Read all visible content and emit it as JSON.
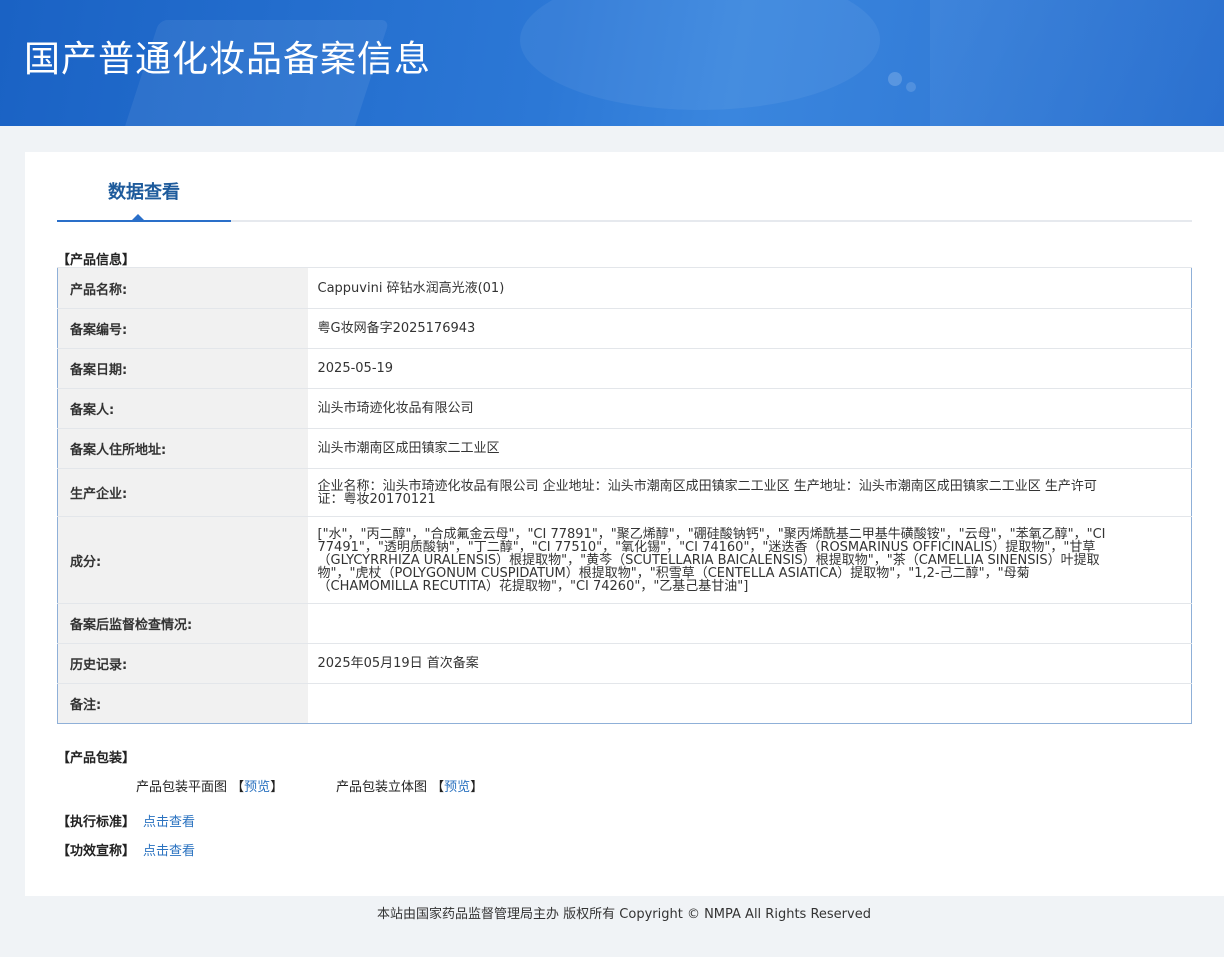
{
  "banner": {
    "title": "国产普通化妆品备案信息"
  },
  "tab": {
    "label": "数据查看"
  },
  "product_info": {
    "section_title": "【产品信息】",
    "rows": [
      {
        "key": "产品名称:",
        "value": "Cappuvini 碎钻水润高光液(01)"
      },
      {
        "key": "备案编号:",
        "value": "粤G妆网备字2025176943"
      },
      {
        "key": "备案日期:",
        "value": "2025-05-19"
      },
      {
        "key": "备案人:",
        "value": "汕头市琦迹化妆品有限公司"
      },
      {
        "key": "备案人住所地址:",
        "value": "汕头市潮南区成田镇家二工业区"
      },
      {
        "key": "生产企业:",
        "value": "企业名称：汕头市琦迹化妆品有限公司 企业地址：汕头市潮南区成田镇家二工业区 生产地址：汕头市潮南区成田镇家二工业区 生产许可证：粤妆20170121"
      },
      {
        "key": "成分:",
        "value": "[\"水\"，\"丙二醇\"，\"合成氟金云母\"，\"CI 77891\"，\"聚乙烯醇\"，\"硼硅酸钠钙\"，\"聚丙烯酰基二甲基牛磺酸铵\"，\"云母\"，\"苯氧乙醇\"，\"CI 77491\"，\"透明质酸钠\"，\"丁二醇\"，\"CI 77510\"，\"氧化锡\"，\"CI 74160\"，\"迷迭香（ROSMARINUS OFFICINALIS）提取物\"，\"甘草（GLYCYRRHIZA URALENSIS）根提取物\"，\"黄芩（SCUTELLARIA BAICALENSIS）根提取物\"，\"茶（CAMELLIA SINENSIS）叶提取物\"，\"虎杖（POLYGONUM CUSPIDATUM）根提取物\"，\"积雪草（CENTELLA ASIATICA）提取物\"，\"1,2-己二醇\"，\"母菊（CHAMOMILLA RECUTITA）花提取物\"，\"CI 74260\"，\"乙基己基甘油\"]"
      },
      {
        "key": "备案后监督检查情况:",
        "value": ""
      },
      {
        "key": "历史记录:",
        "value": "2025年05月19日 首次备案"
      },
      {
        "key": "备注:",
        "value": ""
      }
    ]
  },
  "packaging": {
    "section_title": "【产品包装】",
    "flat_label": "产品包装平面图",
    "flat_link": "预览",
    "solid_label": "产品包装立体图",
    "solid_link": "预览",
    "bracket_open": "【",
    "bracket_close": "】"
  },
  "standard": {
    "label": "【执行标准】",
    "link": "点击查看"
  },
  "efficacy": {
    "label": "【功效宣称】",
    "link": "点击查看"
  },
  "footer": {
    "text": "本站由国家药品监督管理局主办 版权所有 Copyright © NMPA All Rights Reserved"
  }
}
